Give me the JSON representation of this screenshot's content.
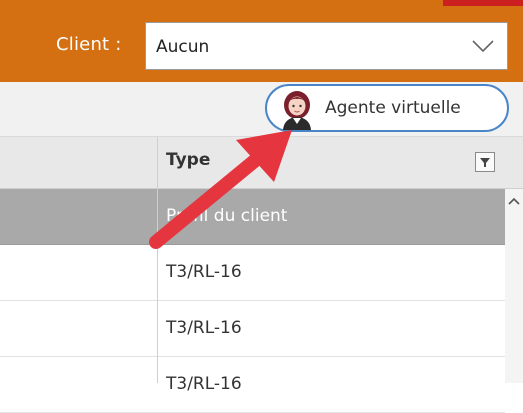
{
  "header": {
    "client_label": "Client :",
    "client_select_value": "Aucun",
    "icons": {
      "dropdown": "chevron-down-icon"
    }
  },
  "toolbar": {
    "agent_button_label": "Agente virtuelle",
    "icons": {
      "avatar": "virtual-agent-avatar-icon"
    }
  },
  "grid": {
    "type_column_header": "Type",
    "rows": [
      {
        "type": "Profil du client"
      },
      {
        "type": "T3/RL-16"
      },
      {
        "type": "T3/RL-16"
      },
      {
        "type": "T3/RL-16"
      }
    ]
  },
  "colors": {
    "header_orange": "#d46f12",
    "accent_blue": "#4a86c7",
    "annotation_red": "#e5353f",
    "selected_row": "#a9a9a9"
  }
}
